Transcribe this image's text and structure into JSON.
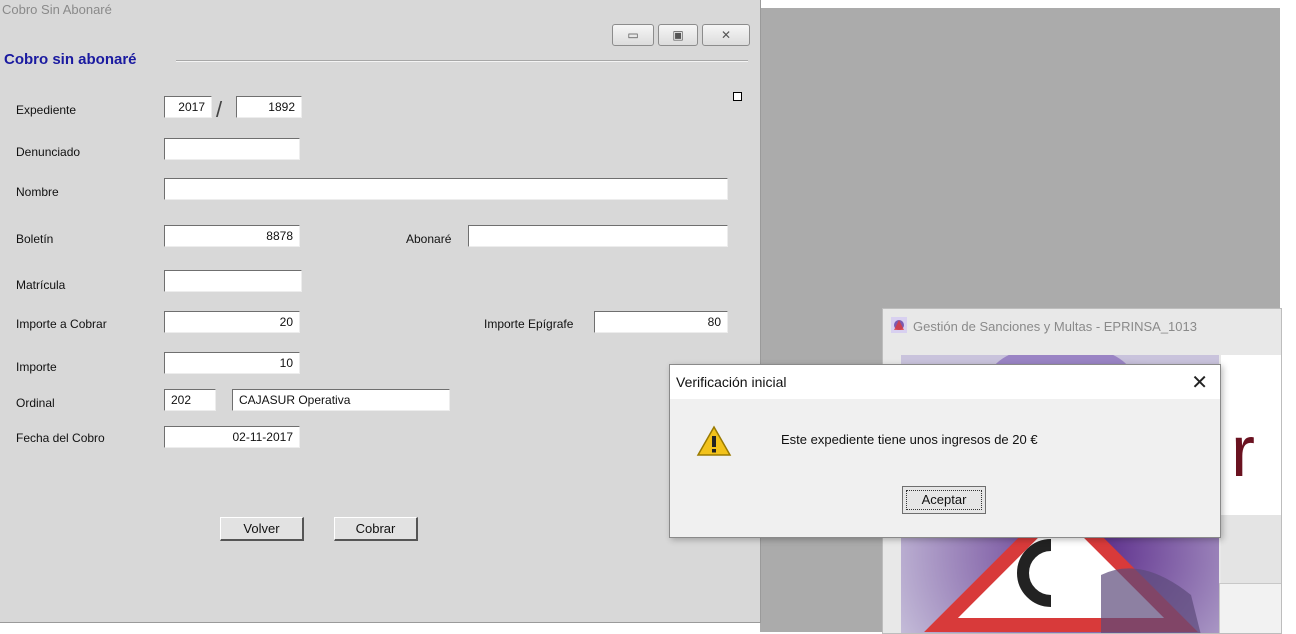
{
  "main_window": {
    "title": "Cobro Sin Abonaré",
    "section_title": "Cobro sin abonaré",
    "controls": {
      "minimize": "▭",
      "maximize": "▣",
      "close": "✕"
    }
  },
  "form": {
    "expediente": {
      "label": "Expediente",
      "year": "2017",
      "number": "1892"
    },
    "denunciado": {
      "label": "Denunciado",
      "value": ""
    },
    "nombre": {
      "label": "Nombre",
      "value": ""
    },
    "boletin": {
      "label": "Boletín",
      "value": "8878"
    },
    "abonare": {
      "label": "Abonaré",
      "value": ""
    },
    "matricula": {
      "label": "Matrícula",
      "value": ""
    },
    "importe_a_cobrar": {
      "label": "Importe a Cobrar",
      "value": "20"
    },
    "importe_epigrafe": {
      "label": "Importe Epígrafe",
      "value": "80"
    },
    "importe": {
      "label": "Importe",
      "value": "10"
    },
    "ordinal": {
      "label": "Ordinal",
      "code": "202",
      "name": "CAJASUR Operativa"
    },
    "fecha_cobro": {
      "label": "Fecha del Cobro",
      "value": "02-11-2017"
    }
  },
  "buttons": {
    "volver": "Volver",
    "cobrar": "Cobrar"
  },
  "background_app": {
    "title": "Gestión de Sanciones y Multas - EPRINSA_1013",
    "partial_letter": "r"
  },
  "dialog": {
    "title": "Verificación inicial",
    "close": "✕",
    "message": "Este expediente tiene unos ingresos de 20 €",
    "button": "Aceptar",
    "icon": "warning-icon"
  }
}
